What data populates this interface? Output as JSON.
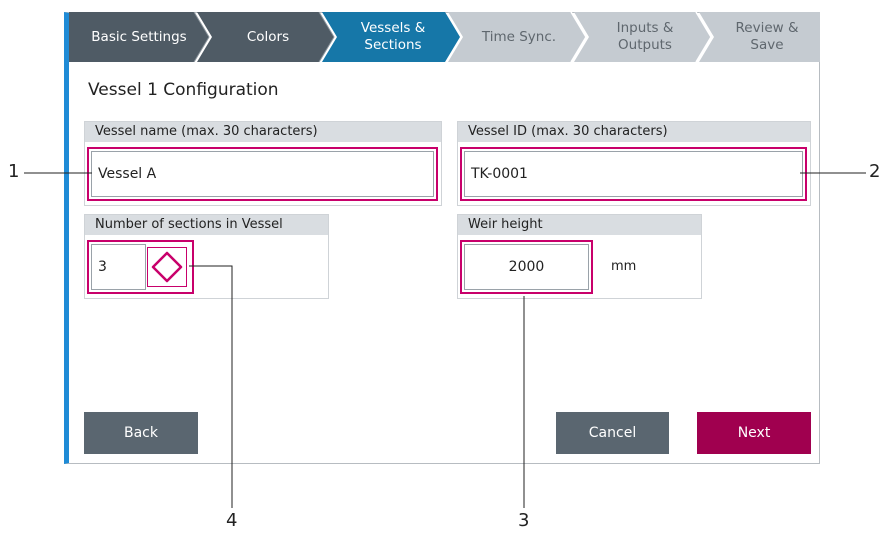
{
  "wizard": {
    "steps": [
      {
        "label": "Basic Settings",
        "state": "done"
      },
      {
        "label": "Colors",
        "state": "done"
      },
      {
        "label": "Vessels &\nSections",
        "state": "active"
      },
      {
        "label": "Time Sync.",
        "state": "pending"
      },
      {
        "label": "Inputs &\nOutputs",
        "state": "pending"
      },
      {
        "label": "Review &\nSave",
        "state": "pending"
      }
    ]
  },
  "page": {
    "title": "Vessel 1 Configuration"
  },
  "vessel_name": {
    "label": "Vessel name (max. 30 characters)",
    "value": "Vessel A"
  },
  "vessel_id": {
    "label": "Vessel ID (max. 30 characters)",
    "value": "TK-0001"
  },
  "sections": {
    "label": "Number of sections in Vessel",
    "value": "3"
  },
  "weir": {
    "label": "Weir height",
    "value": "2000",
    "unit": "mm"
  },
  "buttons": {
    "back": "Back",
    "cancel": "Cancel",
    "next": "Next"
  },
  "callouts": {
    "c1": "1",
    "c2": "2",
    "c3": "3",
    "c4": "4"
  },
  "colors": {
    "accent": "#1f8bd6",
    "step_done": "#4f5b65",
    "step_active": "#1677a8",
    "step_pending": "#c5cbd1",
    "highlight": "#c8006b",
    "next_button": "#a0004f"
  }
}
